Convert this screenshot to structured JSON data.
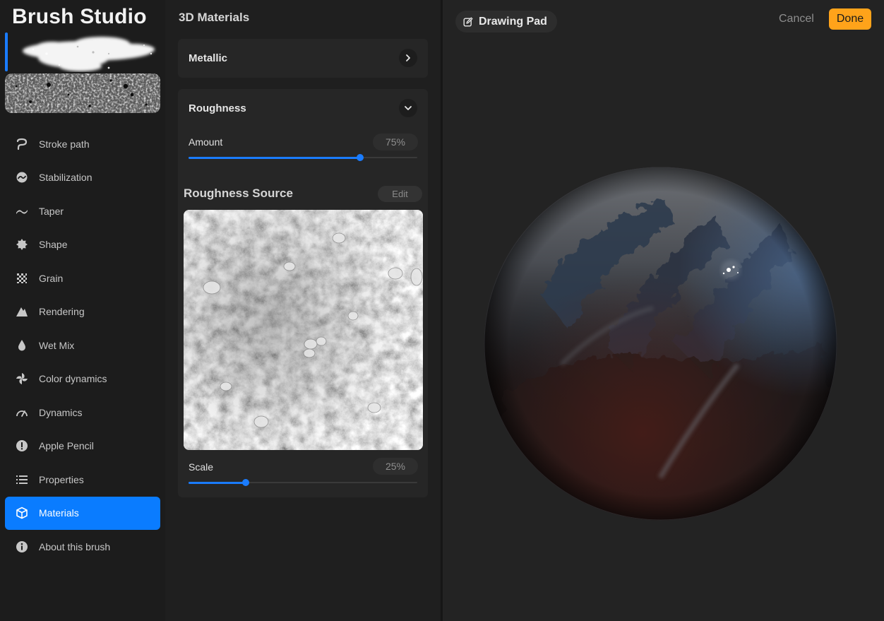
{
  "app": {
    "title": "Brush Studio"
  },
  "sidebar": {
    "items": [
      {
        "label": "Stroke path",
        "icon": "stroke-path-icon",
        "active": false
      },
      {
        "label": "Stabilization",
        "icon": "stabilization-icon",
        "active": false
      },
      {
        "label": "Taper",
        "icon": "taper-icon",
        "active": false
      },
      {
        "label": "Shape",
        "icon": "shape-icon",
        "active": false
      },
      {
        "label": "Grain",
        "icon": "grain-icon",
        "active": false
      },
      {
        "label": "Rendering",
        "icon": "rendering-icon",
        "active": false
      },
      {
        "label": "Wet Mix",
        "icon": "wet-mix-icon",
        "active": false
      },
      {
        "label": "Color dynamics",
        "icon": "color-dynamics-icon",
        "active": false
      },
      {
        "label": "Dynamics",
        "icon": "dynamics-icon",
        "active": false
      },
      {
        "label": "Apple Pencil",
        "icon": "apple-pencil-icon",
        "active": false
      },
      {
        "label": "Properties",
        "icon": "properties-icon",
        "active": false
      },
      {
        "label": "Materials",
        "icon": "materials-icon",
        "active": true
      },
      {
        "label": "About this brush",
        "icon": "info-icon",
        "active": false
      }
    ]
  },
  "panel": {
    "title": "3D Materials",
    "metallic": {
      "label": "Metallic"
    },
    "roughness": {
      "label": "Roughness",
      "amount_label": "Amount",
      "amount_value": "75%",
      "amount_fraction": 0.75
    },
    "roughness_source": {
      "title": "Roughness Source",
      "edit_label": "Edit",
      "scale_label": "Scale",
      "scale_value": "25%",
      "scale_fraction": 0.25
    }
  },
  "preview": {
    "drawing_pad_label": "Drawing Pad",
    "cancel_label": "Cancel",
    "done_label": "Done"
  },
  "colors": {
    "accent": "#0a7cff",
    "done": "#ffa31a"
  }
}
